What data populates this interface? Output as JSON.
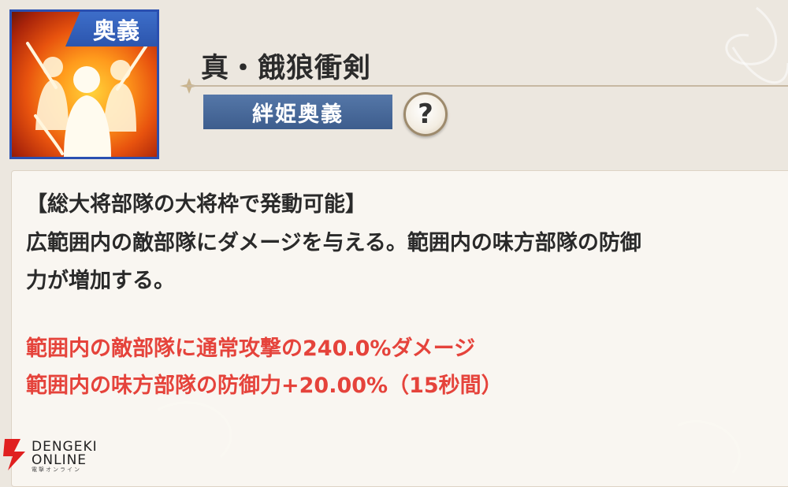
{
  "skill": {
    "badge": "奥義",
    "name": "真・餓狼衝剣",
    "type_tag": "絆姫奥義",
    "help_label": "?"
  },
  "description": {
    "lines": [
      "【総大将部隊の大将枠で発動可能】",
      "広範囲内の敵部隊にダメージを与える。範囲内の味方部隊の防御",
      "力が増加する。"
    ],
    "effects": [
      "範囲内の敵部隊に通常攻撃の240.0%ダメージ",
      "範囲内の味方部隊の防御力+20.00%（15秒間）"
    ]
  },
  "watermark": {
    "line1": "DENGEKI",
    "line2": "ONLINE",
    "line3": "電撃オンライン"
  },
  "colors": {
    "badge_blue": "#2c55ad",
    "tag_blue": "#4a6a9a",
    "effect_red": "#e5433b",
    "text_dark": "#2a2a2a"
  }
}
